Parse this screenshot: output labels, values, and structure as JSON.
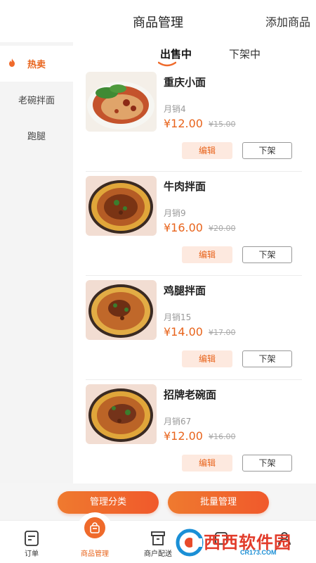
{
  "header": {
    "title": "商品管理",
    "add_label": "添加商品"
  },
  "sidebar": {
    "items": [
      {
        "label": "热卖",
        "active": true
      },
      {
        "label": "老碗拌面",
        "active": false
      },
      {
        "label": "跑腿",
        "active": false
      }
    ]
  },
  "tabs": [
    {
      "label": "出售中",
      "active": true
    },
    {
      "label": "下架中",
      "active": false
    }
  ],
  "products": [
    {
      "name": "重庆小面",
      "sales": "月销4",
      "price": "¥12.00",
      "original_price": "¥15.00",
      "edit_label": "编辑",
      "offshelf_label": "下架"
    },
    {
      "name": "牛肉拌面",
      "sales": "月销9",
      "price": "¥16.00",
      "original_price": "¥20.00",
      "edit_label": "编辑",
      "offshelf_label": "下架"
    },
    {
      "name": "鸡腿拌面",
      "sales": "月销15",
      "price": "¥14.00",
      "original_price": "¥17.00",
      "edit_label": "编辑",
      "offshelf_label": "下架"
    },
    {
      "name": "招牌老碗面",
      "sales": "月销67",
      "price": "¥12.00",
      "original_price": "¥16.00",
      "edit_label": "编辑",
      "offshelf_label": "下架"
    }
  ],
  "actions": {
    "manage_category": "管理分类",
    "batch_manage": "批量管理"
  },
  "bottom_nav": [
    {
      "label": "订单",
      "icon": "order-icon",
      "active": false
    },
    {
      "label": "商品管理",
      "icon": "bag-icon",
      "active": true
    },
    {
      "label": "商户配送",
      "icon": "store-icon",
      "active": false
    },
    {
      "label": "",
      "icon": "data-icon",
      "active": false
    },
    {
      "label": "",
      "icon": "user-icon",
      "active": false
    }
  ],
  "watermark": {
    "brand": "西西软件园",
    "url": "CR173.COM"
  },
  "colors": {
    "accent": "#e8641c",
    "edit_bg": "#fde9df",
    "sidebar_bg": "#f4f4f4"
  }
}
